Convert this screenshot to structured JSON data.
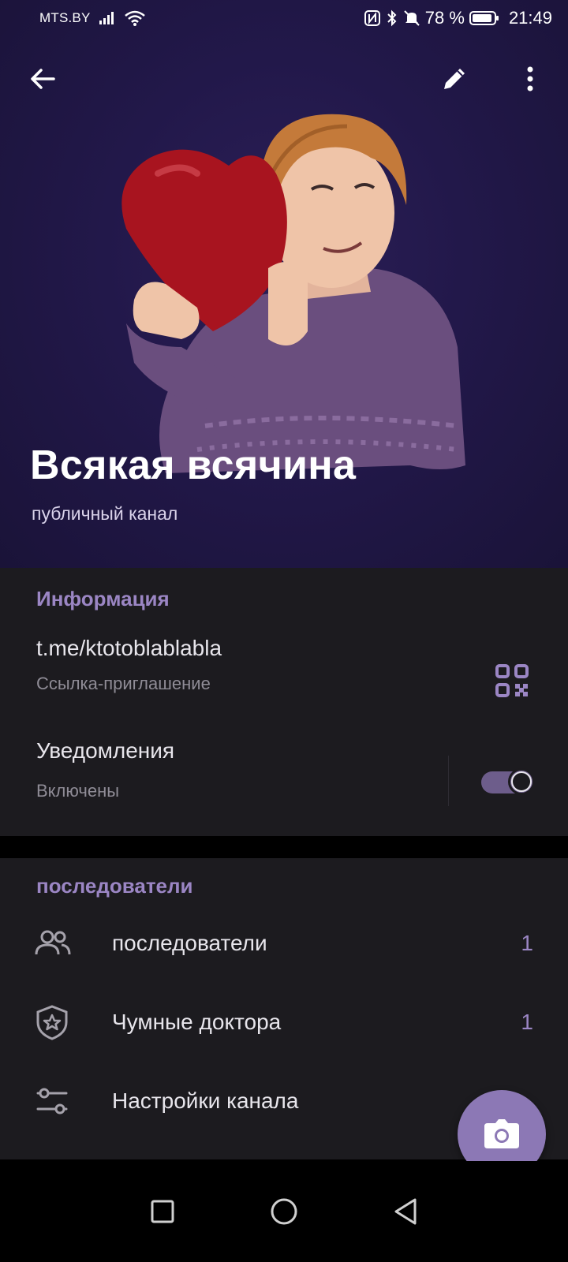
{
  "status_bar": {
    "carrier": "MTS.BY",
    "battery_percent": "78 %",
    "time": "21:49",
    "icons": [
      "signal-icon",
      "wifi-icon",
      "nfc-icon",
      "bluetooth-icon",
      "mute-icon",
      "battery-icon"
    ]
  },
  "top_bar": {
    "back_icon": "arrow-back-icon",
    "edit_icon": "pencil-icon",
    "more_icon": "more-vert-icon"
  },
  "channel": {
    "title": "Всякая всячина",
    "type": "публичный канал"
  },
  "info_section": {
    "title": "Информация",
    "link": "t.me/ktotoblablabla",
    "link_caption": "Ссылка-приглашение",
    "notifications_label": "Уведомления",
    "notifications_status": "Включены",
    "notifications_on": true
  },
  "followers_section": {
    "title": "последователи",
    "items": [
      {
        "label": "последователи",
        "count": "1",
        "icon": "people-icon"
      },
      {
        "label": "Чумные доктора",
        "count": "1",
        "icon": "shield-star-icon"
      },
      {
        "label": "Настройки канала",
        "count": "",
        "icon": "sliders-icon"
      }
    ]
  },
  "fab": {
    "icon": "camera-icon"
  },
  "nav_bar": {
    "icons": [
      "recent-apps-icon",
      "home-icon",
      "back-triangle-icon"
    ]
  },
  "colors": {
    "accent": "#9b86c4",
    "header_bg": "#22184a",
    "panel_bg": "#1c1b1f",
    "fab": "#8c78b5"
  }
}
